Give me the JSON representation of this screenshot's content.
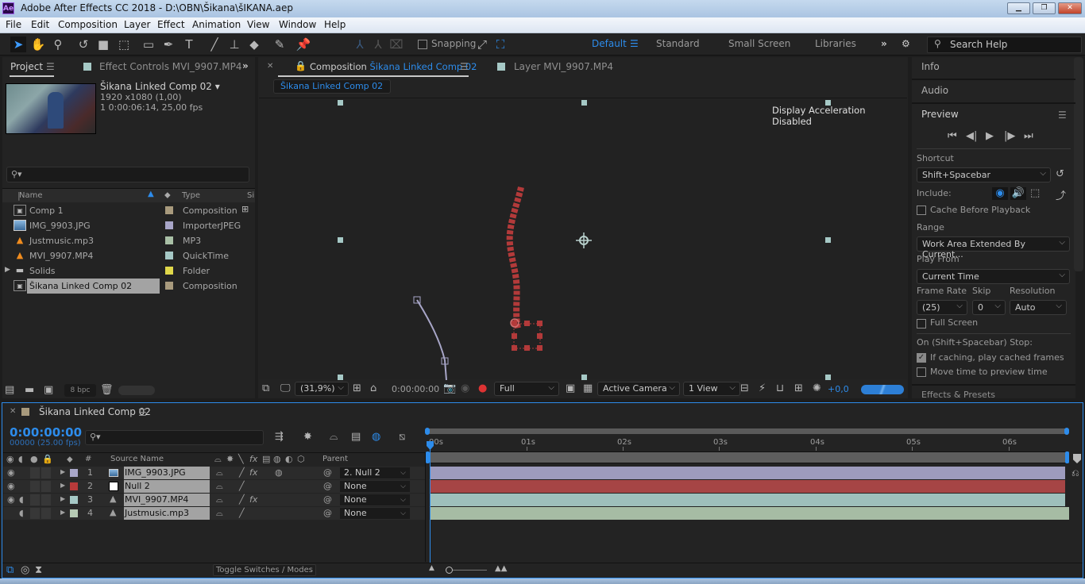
{
  "window": {
    "app_logo": "Ae",
    "title": "Adobe After Effects CC 2018 - D:\\OBN\\Šikana\\šIKANA.aep",
    "minimize": "▁",
    "restore": "❐",
    "close": "✕"
  },
  "menu": [
    "File",
    "Edit",
    "Composition",
    "Layer",
    "Effect",
    "Animation",
    "View",
    "Window",
    "Help"
  ],
  "toolbar": {
    "snapping_label": "Snapping",
    "workspaces": [
      "Default",
      "Standard",
      "Small Screen",
      "Libraries"
    ],
    "active_workspace": "Default",
    "more": "»",
    "search_placeholder": "Search Help"
  },
  "project_panel": {
    "tab_project": "Project",
    "tab_effect_controls": "Effect Controls MVI_9907.MP4",
    "selected_name": "Šikana Linked Comp 02",
    "selected_dims": "1920 x1080 (1,00)",
    "selected_duration": "1 0:00:06:14, 25,00 fps",
    "col_name": "Name",
    "col_type": "Type",
    "col_size": "Si",
    "items": [
      {
        "name": "Comp 1",
        "type": "Composition",
        "icon": "composition-icon",
        "color": "#a89a7d"
      },
      {
        "name": "IMG_9903.JPG",
        "type": "ImporterJPEG",
        "icon": "image-icon",
        "color": "#a8a6c8"
      },
      {
        "name": "Justmusic.mp3",
        "type": "MP3",
        "icon": "vlc-cone-icon",
        "color": "#a9c0a6"
      },
      {
        "name": "MVI_9907.MP4",
        "type": "QuickTime",
        "icon": "vlc-cone-icon",
        "color": "#a6c9c6"
      },
      {
        "name": "Solids",
        "type": "Folder",
        "icon": "folder-icon",
        "color": "#e0d84a"
      },
      {
        "name": "Šikana Linked Comp 02",
        "type": "Composition",
        "icon": "composition-icon",
        "color": "#a89a7d"
      }
    ],
    "bpc": "8 bpc"
  },
  "comp_panel": {
    "tab_prefix": "Composition",
    "tab_comp_name": "Šikana Linked Comp 02",
    "tab_layer": "Layer MVI_9907.MP4",
    "breadcrumb": "Šikana Linked Comp 02",
    "notice": "Display Acceleration Disabled",
    "zoom": "(31,9%)",
    "timecode": "0:00:00:00",
    "resolution": "Full",
    "camera": "Active Camera",
    "view": "1 View",
    "exposure": "+0,0"
  },
  "right_panel": {
    "info": "Info",
    "audio": "Audio",
    "preview": "Preview",
    "shortcut_label": "Shortcut",
    "shortcut_value": "Shift+Spacebar",
    "include_label": "Include:",
    "cache_before_playback": "Cache Before Playback",
    "cache_before_playback_checked": false,
    "range_label": "Range",
    "range_value": "Work Area Extended By Current...",
    "play_from_label": "Play From",
    "play_from_value": "Current Time",
    "frame_rate_label": "Frame Rate",
    "frame_rate_value": "(25)",
    "skip_label": "Skip",
    "skip_value": "0",
    "resolution_label": "Resolution",
    "resolution_value": "Auto",
    "full_screen": "Full Screen",
    "full_screen_checked": false,
    "stop_label": "On (Shift+Spacebar) Stop:",
    "if_caching": "If caching, play cached frames",
    "if_caching_checked": true,
    "move_time": "Move time to preview time",
    "move_time_checked": false,
    "effects_presets": "Effects & Presets"
  },
  "timeline": {
    "tab_name": "Šikana Linked Comp 02",
    "current_time": "0:00:00:00",
    "frame_info": "00000 (25.00 fps)",
    "col_hash": "#",
    "col_source_name": "Source Name",
    "col_parent": "Parent",
    "ruler": [
      "00s",
      "01s",
      "02s",
      "03s",
      "04s",
      "05s",
      "06s"
    ],
    "layers": [
      {
        "num": "1",
        "name": "IMG_9903.JPG",
        "color": "#a8a6c8",
        "bar_color": "#9d9bbd",
        "icon": "image-icon",
        "parent": "2. Null 2",
        "video": true,
        "audio": false,
        "fx": true
      },
      {
        "num": "2",
        "name": "Null 2",
        "color": "#b73a3a",
        "bar_color": "#a64545",
        "icon": "null-icon",
        "parent": "None",
        "video": true,
        "audio": false,
        "fx": false
      },
      {
        "num": "3",
        "name": "MVI_9907.MP4",
        "color": "#a6c9c6",
        "bar_color": "#9ebfbb",
        "icon": "vlc-cone-icon",
        "parent": "None",
        "video": true,
        "audio": true,
        "fx": true
      },
      {
        "num": "4",
        "name": "Justmusic.mp3",
        "color": "#b6cab4",
        "bar_color": "#a6bca4",
        "icon": "vlc-cone-icon",
        "parent": "None",
        "video": false,
        "audio": true,
        "fx": false
      }
    ],
    "toggle_label": "Toggle Switches / Modes"
  }
}
